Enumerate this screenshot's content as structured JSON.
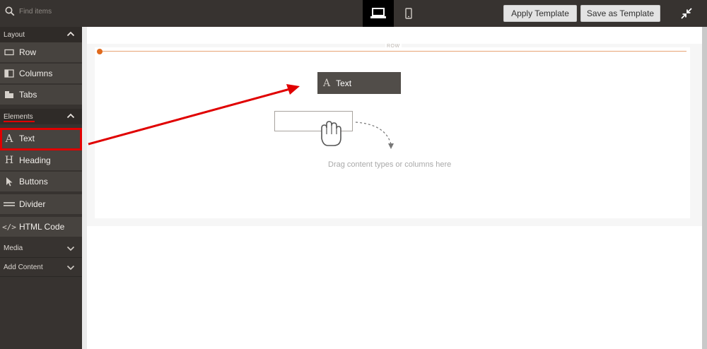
{
  "search": {
    "placeholder": "Find items",
    "icon": "search-icon"
  },
  "devices": [
    {
      "name": "desktop",
      "icon": "desktop-icon",
      "active": true
    },
    {
      "name": "mobile",
      "icon": "mobile-icon",
      "active": false
    }
  ],
  "toolbar": {
    "apply_label": "Apply Template",
    "save_label": "Save as Template",
    "fullscreen_icon": "collapse-icon"
  },
  "sidebar": {
    "layout": {
      "label": "Layout",
      "expanded": true,
      "items": [
        {
          "label": "Row",
          "icon": "row-icon"
        },
        {
          "label": "Columns",
          "icon": "columns-icon"
        },
        {
          "label": "Tabs",
          "icon": "tabs-icon"
        }
      ]
    },
    "elements": {
      "label": "Elements",
      "expanded": true,
      "items": [
        {
          "label": "Text",
          "icon": "text-icon",
          "highlighted": true
        },
        {
          "label": "Heading",
          "icon": "heading-icon"
        },
        {
          "label": "Buttons",
          "icon": "buttons-icon"
        },
        {
          "label": "Divider",
          "icon": "divider-icon"
        },
        {
          "label": "HTML Code",
          "icon": "html-code-icon"
        }
      ]
    },
    "media": {
      "label": "Media",
      "expanded": false
    },
    "add_content": {
      "label": "Add Content",
      "expanded": false
    }
  },
  "stage": {
    "row_label": "ROW",
    "dragging_item": {
      "label": "Text",
      "icon": "text-icon"
    },
    "drop_hint": "Drag content types or columns here",
    "hand_icon": "grab-hand-icon"
  },
  "colors": {
    "panel_bg": "#373330",
    "item_bg": "#47433f",
    "accent_orange": "#e06a1d",
    "annotation_red": "#e00000"
  }
}
